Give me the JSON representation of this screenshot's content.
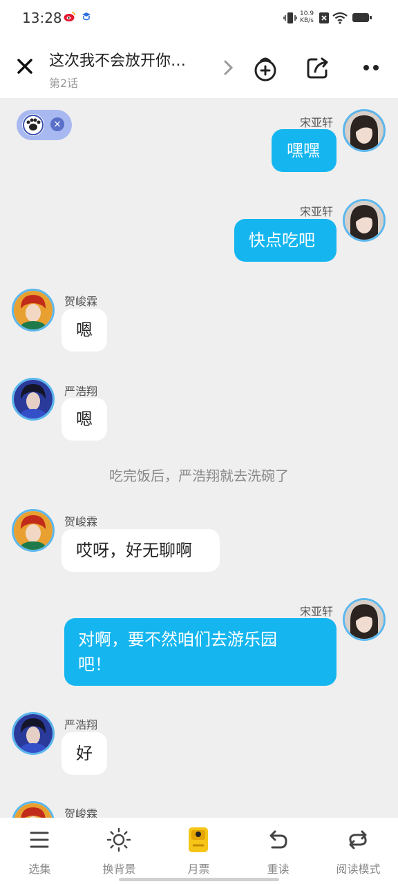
{
  "status_bar": {
    "time": "13:28",
    "net_speed_value": "10.9",
    "net_speed_unit": "KB/s"
  },
  "header": {
    "title": "这次我不会放开你…",
    "subtitle": "第2话"
  },
  "messages": [
    {
      "speaker": "宋亚轩",
      "text": "嘿嘿",
      "side": "right"
    },
    {
      "speaker": "宋亚轩",
      "text": "快点吃吧",
      "side": "right"
    },
    {
      "speaker": "贺峻霖",
      "text": "嗯",
      "side": "left"
    },
    {
      "speaker": "严浩翔",
      "text": "嗯",
      "side": "left"
    },
    {
      "speaker": "贺峻霖",
      "text": "哎呀，好无聊啊",
      "side": "left"
    },
    {
      "speaker": "宋亚轩",
      "text_line1": "对啊，要不然咱们去游乐园",
      "text_line2": "吧！",
      "side": "right"
    },
    {
      "speaker": "严浩翔",
      "text": "好",
      "side": "left"
    },
    {
      "speaker": "贺峻霖",
      "side": "left"
    }
  ],
  "narration": "吃完饭后，严浩翔就去洗碗了",
  "bottom_nav": [
    {
      "label": "选集",
      "icon": "list-icon"
    },
    {
      "label": "换背景",
      "icon": "sun-icon"
    },
    {
      "label": "月票",
      "icon": "ticket-icon"
    },
    {
      "label": "重读",
      "icon": "undo-icon"
    },
    {
      "label": "阅读模式",
      "icon": "loop-icon"
    }
  ],
  "colors": {
    "bubble_right": "#15b6f0",
    "bubble_left": "#ffffff",
    "avatar_ring": "#5bb7ee",
    "background": "#efefef"
  }
}
